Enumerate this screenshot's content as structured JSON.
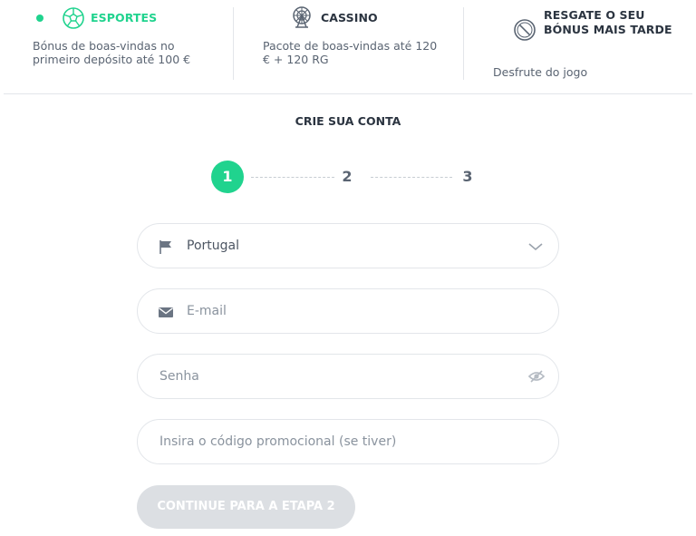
{
  "colors": {
    "accent": "#20d38e",
    "text": "#2b3440",
    "muted": "#5a6472",
    "border": "#e3e6ea",
    "disabled_button": "#dcdfe3"
  },
  "bonus_options": {
    "sports": {
      "title": "ESPORTES",
      "description": "Bónus de boas-vindas no primeiro depósito até 100 €",
      "icon": "soccer-ball-icon",
      "selected": true
    },
    "casino": {
      "title": "CASSINO",
      "description": "Pacote de boas-vindas até 120 € + 120 RG",
      "icon": "ferris-wheel-icon",
      "selected": false
    },
    "later": {
      "title": "RESGATE O SEU BÓNUS MAIS TARDE",
      "description": "Desfrute do jogo",
      "icon": "prohibited-icon",
      "selected": false
    }
  },
  "registration": {
    "title": "CRIE SUA CONTA",
    "steps": [
      "1",
      "2",
      "3"
    ],
    "current_step": 1,
    "country": {
      "value": "Portugal",
      "icon": "flag-icon"
    },
    "email": {
      "placeholder": "E-mail",
      "icon": "envelope-icon"
    },
    "password": {
      "placeholder": "Senha",
      "icon": "eye-hidden-icon"
    },
    "promo": {
      "placeholder": "Insira o código promocional (se tiver)"
    },
    "continue_label": "CONTINUE PARA A ETAPA 2"
  }
}
